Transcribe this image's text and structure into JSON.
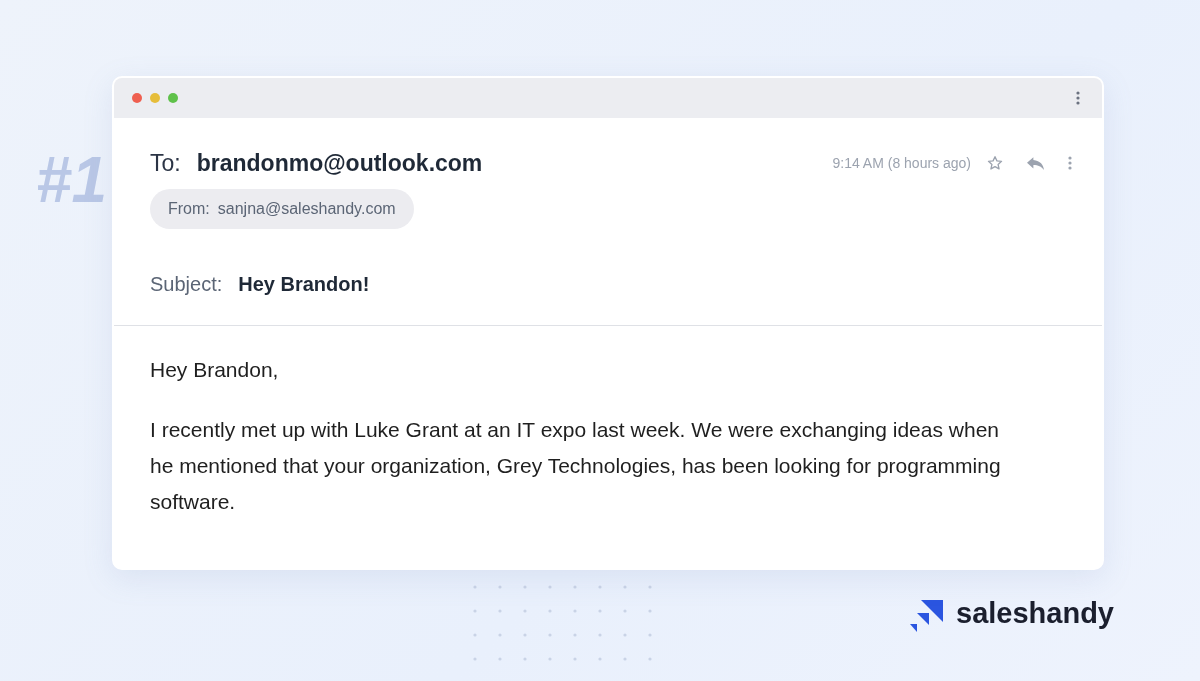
{
  "badge": "#1",
  "email": {
    "to_label": "To:",
    "to": "brandonmo@outlook.com",
    "from_label": "From:",
    "from": "sanjna@saleshandy.com",
    "time": "9:14 AM (8 hours ago)",
    "subject_label": "Subject:",
    "subject": "Hey Brandon!",
    "body": [
      "Hey Brandon,",
      "I recently met up with Luke Grant at an IT expo last week. We were exchanging ideas when he mentioned that your organization, Grey Technologies, has been looking for programming software."
    ]
  },
  "brand": {
    "name": "saleshandy"
  }
}
